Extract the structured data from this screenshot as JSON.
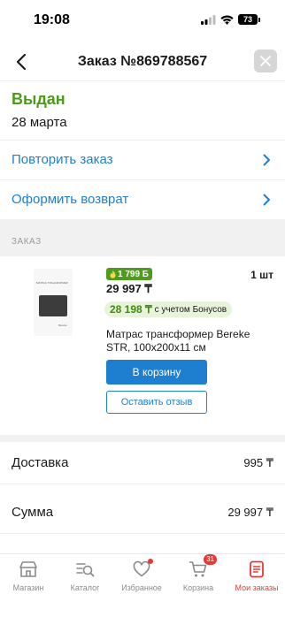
{
  "status_bar": {
    "time": "19:08",
    "battery": "73"
  },
  "header": {
    "title": "Заказ №869788567"
  },
  "order": {
    "status": "Выдан",
    "date": "28 марта"
  },
  "actions": [
    {
      "label": "Повторить заказ"
    },
    {
      "label": "Оформить возврат"
    }
  ],
  "section": {
    "label": "ЗАКАЗ"
  },
  "product": {
    "bonus_badge": "1 799 Б",
    "quantity": "1 шт",
    "price": "29 997 ₸",
    "bonus_price": "28 198 ₸",
    "bonus_note": "с учетом Бонусов",
    "name": "Матрас трансформер Bereke STR, 100x200x11 см",
    "cart_button": "В корзину",
    "review_button": "Оставить отзыв",
    "thumb_title": "МАТРАС ТРАНСФОРМЕР",
    "thumb_sub": "Bereke"
  },
  "summary": [
    {
      "label": "Доставка",
      "value": "995 ₸"
    },
    {
      "label": "Сумма",
      "value": "29 997 ₸"
    }
  ],
  "tabbar": {
    "items": [
      {
        "label": "Магазин",
        "icon": "shop-icon"
      },
      {
        "label": "Каталог",
        "icon": "catalog-search-icon"
      },
      {
        "label": "Избранное",
        "icon": "heart-icon"
      },
      {
        "label": "Корзина",
        "icon": "cart-icon",
        "badge": "31"
      },
      {
        "label": "Мои заказы",
        "icon": "orders-icon"
      }
    ]
  },
  "colors": {
    "accent_blue": "#1e7fd0",
    "status_green": "#4a9b18",
    "active_red": "#e53935"
  }
}
